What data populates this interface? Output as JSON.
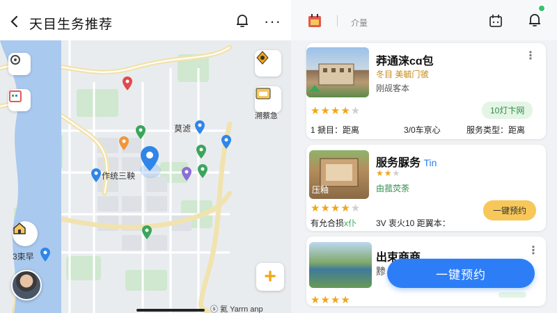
{
  "header": {
    "title": "天目生务推荐",
    "back_icon": "chevron-left-icon",
    "bell_icon": "bell-icon",
    "more_label": "···"
  },
  "map": {
    "labels": {
      "label_a": "莫滤",
      "label_b": "作统三鞅",
      "label_c": "3束早",
      "side_card": "溯蔡急",
      "attribution": "ⓢ 氦 Yarrn  anp"
    },
    "plus_label": "+",
    "colors": {
      "river": "#a9c9ef",
      "park": "#cfe8cf",
      "road": "#ffffff",
      "highway": "#f1e3b0",
      "pin_blue": "#2f86e8"
    }
  },
  "right": {
    "tab_label": "介量",
    "cards": [
      {
        "title": "莽通涞cɑ包",
        "sub1": "冬目 美毓门虢",
        "sub2": "刚觇客本",
        "rating": 3,
        "pill": "10灯卞网",
        "row_left": "1 搋目：距离",
        "row_mid": "3/0车亰心",
        "row_right": "服务类型：距离"
      },
      {
        "title": "服务脲务",
        "title_tail": "Tin",
        "sub1": "由菰荧荼",
        "thumb_label": "压釉",
        "rating": 4,
        "pill": "一键预约",
        "row_left": "有允合损",
        "row_left_tail": "x仆",
        "row_mid": "3V 衷火10 距翼本："
      },
      {
        "title": "出束商商",
        "sub1": "黪",
        "rating": 4
      }
    ],
    "fab_label": "一键预约"
  }
}
